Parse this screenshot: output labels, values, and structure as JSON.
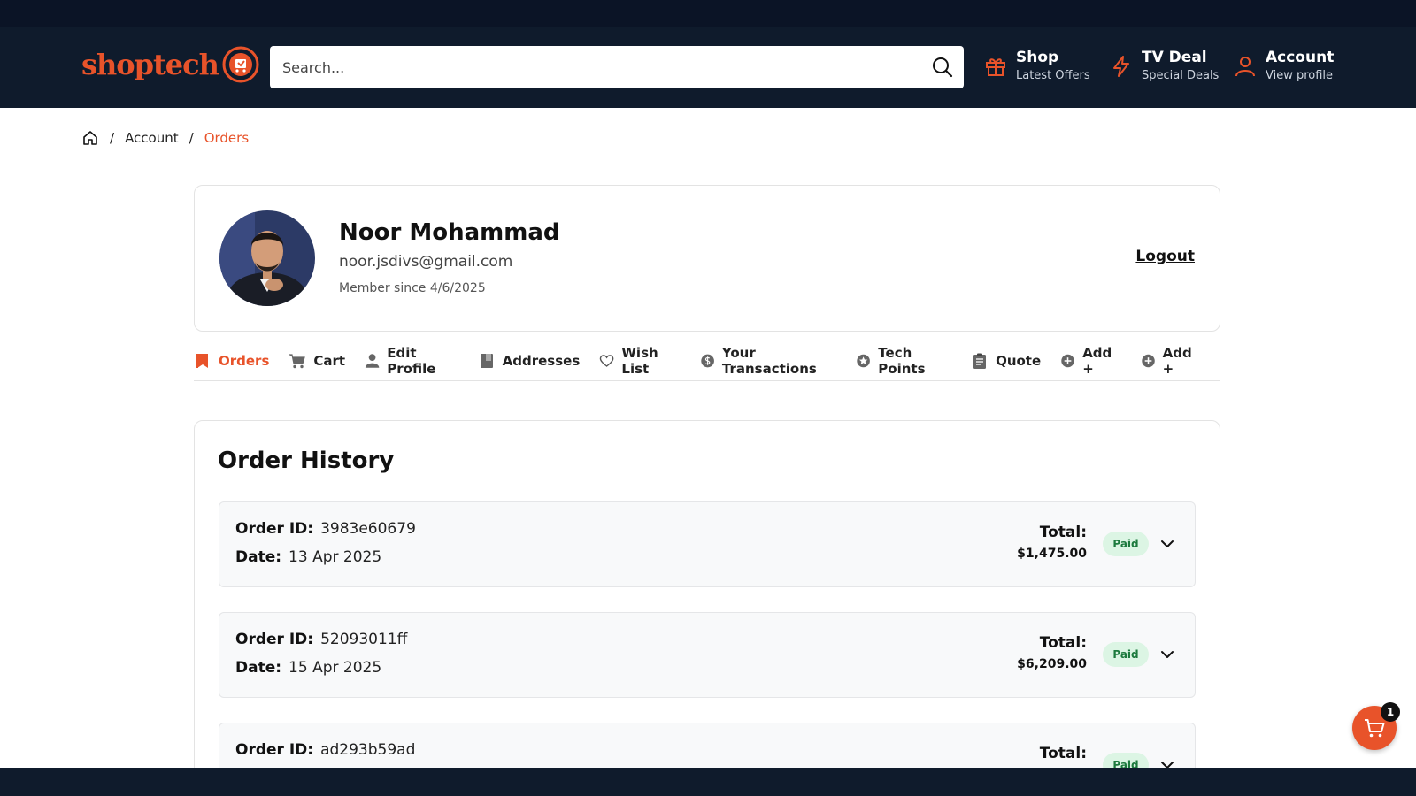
{
  "header": {
    "logo_text": "shoptech",
    "search_placeholder": "Search...",
    "nav": [
      {
        "title": "Shop",
        "subtitle": "Latest Offers",
        "icon": "gift-icon"
      },
      {
        "title": "TV Deal",
        "subtitle": "Special Deals",
        "icon": "lightning-icon"
      },
      {
        "title": "Account",
        "subtitle": "View profile",
        "icon": "user-icon"
      }
    ]
  },
  "breadcrumb": {
    "items": [
      "Account",
      "Orders"
    ],
    "separator": "/"
  },
  "profile": {
    "name": "Noor Mohammad",
    "email": "noor.jsdivs@gmail.com",
    "member_since": "Member since 4/6/2025",
    "logout_label": "Logout"
  },
  "tabs": [
    {
      "label": "Orders",
      "icon": "bookmark-icon",
      "active": true
    },
    {
      "label": "Cart",
      "icon": "cart-icon"
    },
    {
      "label": "Edit Profile",
      "icon": "user-icon"
    },
    {
      "label": "Addresses",
      "icon": "book-icon"
    },
    {
      "label": "Wish List",
      "icon": "heart-icon"
    },
    {
      "label": "Your Transactions",
      "icon": "dollar-icon"
    },
    {
      "label": "Tech Points",
      "icon": "star-icon"
    },
    {
      "label": "Quote",
      "icon": "clipboard-icon"
    },
    {
      "label": "Add +",
      "icon": "plus-circle-icon"
    },
    {
      "label": "Add +",
      "icon": "plus-circle-icon"
    }
  ],
  "order_history": {
    "title": "Order History",
    "labels": {
      "order_id": "Order ID:",
      "date": "Date:",
      "total": "Total:"
    },
    "orders": [
      {
        "id": "3983e60679",
        "date": "13 Apr 2025",
        "total": "$1,475.00",
        "status": "Paid"
      },
      {
        "id": "52093011ff",
        "date": "15 Apr 2025",
        "total": "$6,209.00",
        "status": "Paid"
      },
      {
        "id": "ad293b59ad",
        "date": "",
        "total": "",
        "status": "Paid"
      }
    ]
  },
  "cart_fab": {
    "count": "1"
  },
  "colors": {
    "accent": "#e8532a",
    "header_bg": "#0f1b2c",
    "paid_bg": "#dcf5e4",
    "paid_text": "#1d7a3e"
  }
}
